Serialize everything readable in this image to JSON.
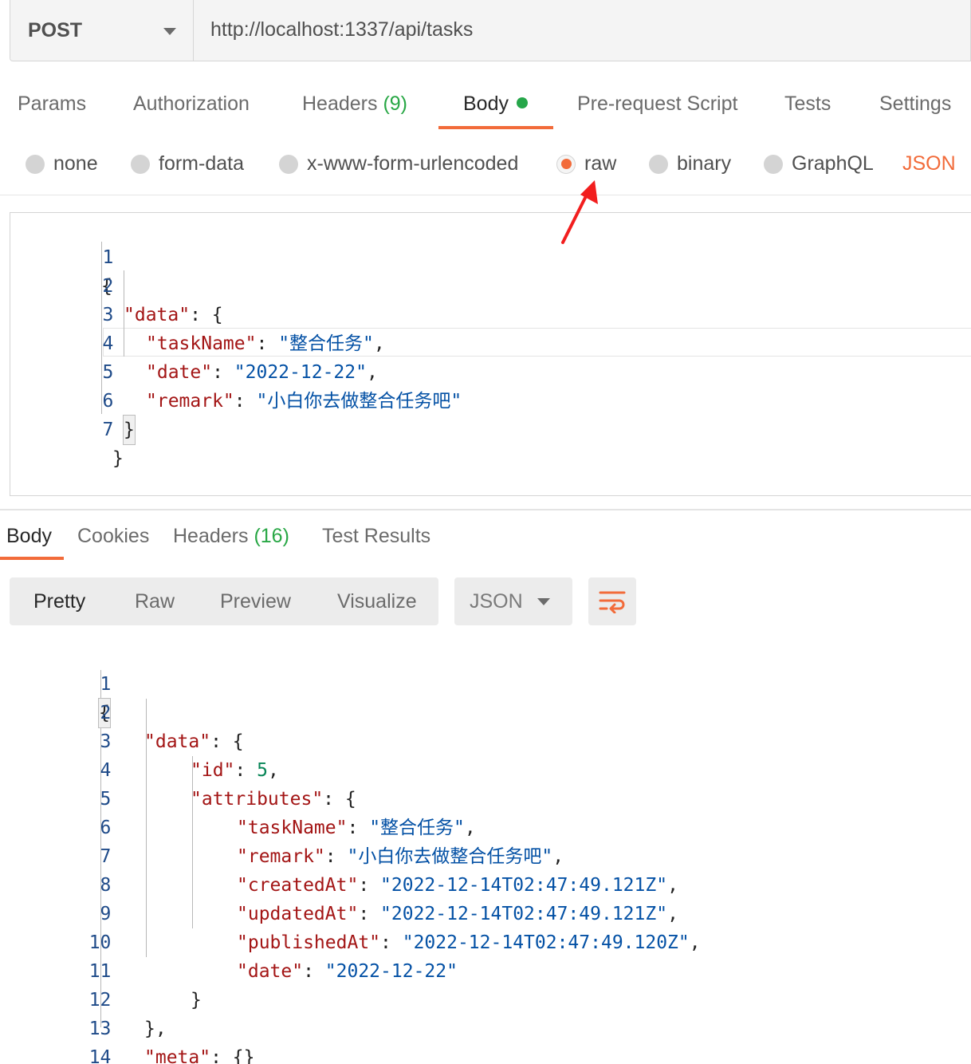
{
  "request": {
    "method": "POST",
    "url": "http://localhost:1337/api/tasks"
  },
  "request_tabs": {
    "params": "Params",
    "authorization": "Authorization",
    "headers": "Headers",
    "headers_count": "(9)",
    "body": "Body",
    "prerequest": "Pre-request Script",
    "tests": "Tests",
    "settings": "Settings"
  },
  "body_types": {
    "none": "none",
    "form_data": "form-data",
    "urlencoded": "x-www-form-urlencoded",
    "raw": "raw",
    "binary": "binary",
    "graphql": "GraphQL",
    "format": "JSON",
    "selected": "raw"
  },
  "request_body": {
    "line_numbers": [
      "1",
      "2",
      "3",
      "4",
      "5",
      "6",
      "7"
    ],
    "l1": "{",
    "l2_key": "\"data\"",
    "l2_rest": ": {",
    "l3_key": "\"taskName\"",
    "l3_val": "\"整合任务\"",
    "l4_key": "\"date\"",
    "l4_val": "\"2022-12-22\"",
    "l5_key": "\"remark\"",
    "l5_val": "\"小白你去做整合任务吧\"",
    "l6": "}",
    "l7": "}"
  },
  "response_tabs": {
    "body": "Body",
    "cookies": "Cookies",
    "headers": "Headers",
    "headers_count": "(16)",
    "test_results": "Test Results"
  },
  "view_modes": {
    "pretty": "Pretty",
    "raw": "Raw",
    "preview": "Preview",
    "visualize": "Visualize",
    "format": "JSON"
  },
  "response_body": {
    "line_numbers": [
      "1",
      "2",
      "3",
      "4",
      "5",
      "6",
      "7",
      "8",
      "9",
      "10",
      "11",
      "12",
      "13",
      "14"
    ],
    "l1": "{",
    "l2_key": "\"data\"",
    "l2_rest": ": {",
    "l3_key": "\"id\"",
    "l3_val": "5",
    "l4_key": "\"attributes\"",
    "l4_rest": ": {",
    "l5_key": "\"taskName\"",
    "l5_val": "\"整合任务\"",
    "l6_key": "\"remark\"",
    "l6_val": "\"小白你去做整合任务吧\"",
    "l7_key": "\"createdAt\"",
    "l7_val": "\"2022-12-14T02:47:49.121Z\"",
    "l8_key": "\"updatedAt\"",
    "l8_val": "\"2022-12-14T02:47:49.121Z\"",
    "l9_key": "\"publishedAt\"",
    "l9_val": "\"2022-12-14T02:47:49.120Z\"",
    "l10_key": "\"date\"",
    "l10_val": "\"2022-12-22\"",
    "l11": "}",
    "l12": "},",
    "l13_key": "\"meta\"",
    "l13_rest": ": {}",
    "l14": "}"
  },
  "colors": {
    "accent": "#f26b3a",
    "count_green": "#28a745",
    "json_key": "#a31515",
    "json_string": "#0451a5",
    "json_number": "#098658"
  }
}
